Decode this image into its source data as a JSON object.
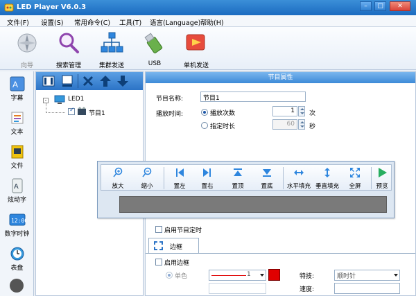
{
  "window": {
    "title": "LED Player V6.0.3",
    "minimize": "–",
    "maximize": "□",
    "close": "✕"
  },
  "menu": [
    "文件(F)",
    "设置(S)",
    "常用命令(C)",
    "工具(T)",
    "语言(Language)",
    "帮助(H)"
  ],
  "toolbar": {
    "wizard": "向导",
    "search": "搜索管理",
    "cluster": "集群发送",
    "usb": "USB",
    "single_send": "单机发送"
  },
  "sidebar": [
    "字幕",
    "文本",
    "文件",
    "炫动字",
    "数字时钟",
    "表盘"
  ],
  "tree": {
    "root": "LED1",
    "child": "节目1"
  },
  "props": {
    "header": "节目属性",
    "name_label": "节目名称:",
    "name_value": "节目1",
    "time_label": "播放时间:",
    "play_count_label": "播放次数",
    "play_count_value": "1",
    "count_unit": "次",
    "duration_label": "指定时长",
    "duration_value": "60",
    "duration_unit": "秒",
    "enable_timer": "启用节目定时",
    "tab_border": "边框",
    "enable_border": "启用边框",
    "single_color": "单色",
    "line_value": "1",
    "effect_label": "特技:",
    "effect_value": "顺时针",
    "speed_label": "速度:"
  },
  "floatbar": [
    "放大",
    "缩小",
    "置左",
    "置右",
    "置顶",
    "置底",
    "水平填充",
    "垂直填充",
    "全屏",
    "预览"
  ],
  "colors": {
    "accent": "#2b73c6",
    "preview": "#7a7a7a",
    "border_color": "#e00000"
  }
}
